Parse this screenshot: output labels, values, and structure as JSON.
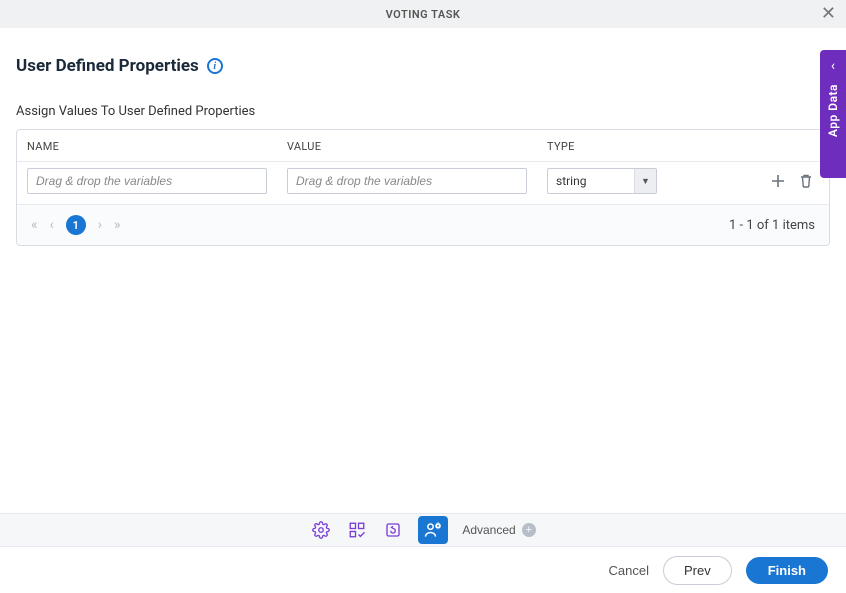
{
  "header": {
    "title": "VOTING TASK"
  },
  "side_panel": {
    "label": "App Data"
  },
  "section": {
    "title": "User Defined Properties",
    "subtitle": "Assign Values To User Defined Properties"
  },
  "table": {
    "columns": {
      "name": "NAME",
      "value": "VALUE",
      "type": "TYPE"
    },
    "rows": [
      {
        "name_placeholder": "Drag & drop the variables",
        "name_value": "",
        "value_placeholder": "Drag & drop the variables",
        "value_value": "",
        "type_selected": "string"
      }
    ]
  },
  "pager": {
    "current": "1",
    "summary": "1 - 1 of 1 items"
  },
  "toolbar": {
    "advanced_label": "Advanced"
  },
  "footer": {
    "cancel": "Cancel",
    "prev": "Prev",
    "finish": "Finish"
  }
}
